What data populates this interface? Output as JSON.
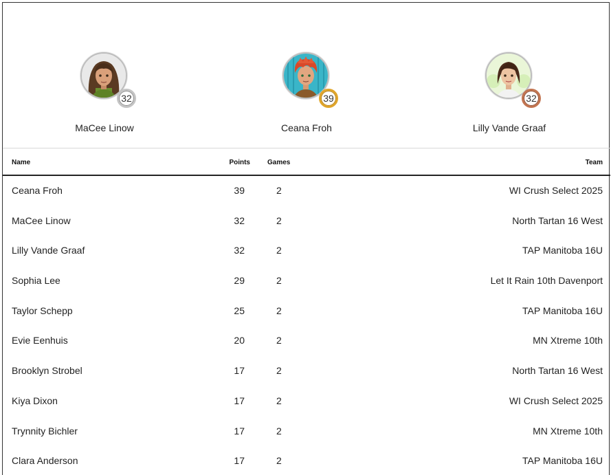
{
  "podium": [
    {
      "name": "MaCee Linow",
      "score": "32",
      "medal": "silver",
      "avatar_icon": "girl-avatar-curly-brown-icon"
    },
    {
      "name": "Ceana Froh",
      "score": "39",
      "medal": "gold",
      "avatar_icon": "girl-avatar-red-hair-icon"
    },
    {
      "name": "Lilly Vande Graaf",
      "score": "32",
      "medal": "bronze",
      "avatar_icon": "girl-avatar-dark-bob-icon"
    }
  ],
  "table": {
    "headers": {
      "name": "Name",
      "points": "Points",
      "games": "Games",
      "team": "Team"
    },
    "rows": [
      {
        "name": "Ceana Froh",
        "points": "39",
        "games": "2",
        "team": "WI Crush Select 2025"
      },
      {
        "name": "MaCee Linow",
        "points": "32",
        "games": "2",
        "team": "North Tartan 16 West"
      },
      {
        "name": "Lilly Vande Graaf",
        "points": "32",
        "games": "2",
        "team": "TAP Manitoba 16U"
      },
      {
        "name": "Sophia Lee",
        "points": "29",
        "games": "2",
        "team": "Let It Rain 10th Davenport"
      },
      {
        "name": "Taylor Schepp",
        "points": "25",
        "games": "2",
        "team": "TAP Manitoba 16U"
      },
      {
        "name": "Evie Eenhuis",
        "points": "20",
        "games": "2",
        "team": "MN Xtreme 10th"
      },
      {
        "name": "Brooklyn Strobel",
        "points": "17",
        "games": "2",
        "team": "North Tartan 16 West"
      },
      {
        "name": "Kiya Dixon",
        "points": "17",
        "games": "2",
        "team": "WI Crush Select 2025"
      },
      {
        "name": "Trynnity Bichler",
        "points": "17",
        "games": "2",
        "team": "MN Xtreme 10th"
      },
      {
        "name": "Clara Anderson",
        "points": "17",
        "games": "2",
        "team": "TAP Manitoba 16U"
      }
    ]
  },
  "colors": {
    "gold": "#e0a52a",
    "silver": "#c4c4c4",
    "bronze": "#c27450"
  }
}
